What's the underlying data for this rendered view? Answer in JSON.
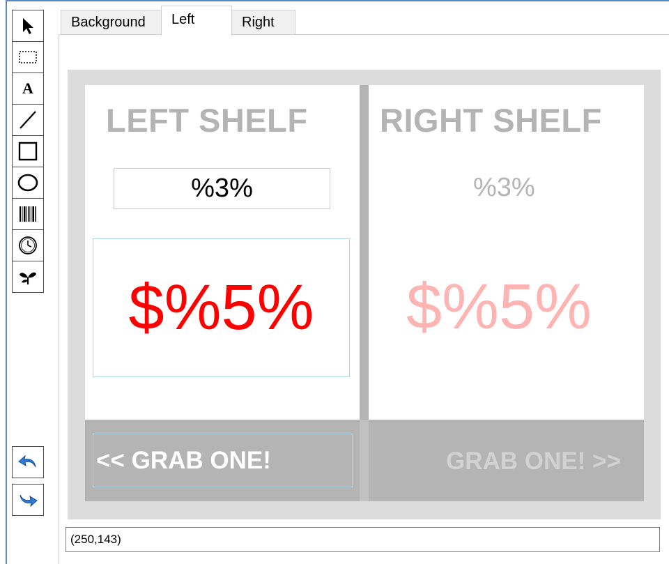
{
  "tools": [
    {
      "name": "pointer-icon"
    },
    {
      "name": "marquee-select-icon"
    },
    {
      "name": "text-icon",
      "glyph": "A"
    },
    {
      "name": "line-icon"
    },
    {
      "name": "rectangle-icon"
    },
    {
      "name": "ellipse-icon"
    },
    {
      "name": "barcode-icon"
    },
    {
      "name": "clock-icon"
    },
    {
      "name": "leaf-icon"
    }
  ],
  "history": [
    {
      "name": "undo-icon",
      "color": "#2e7bd6"
    },
    {
      "name": "redo-icon",
      "color": "#2e7bd6"
    }
  ],
  "tabs": [
    {
      "label": "Background",
      "active": false
    },
    {
      "label": "Left",
      "active": true
    },
    {
      "label": "Right",
      "active": false
    }
  ],
  "canvas": {
    "left_shelf": {
      "title": "LEFT SHELF",
      "percent_text": "%3%",
      "price_text": "$%5%",
      "grab_text": "<< GRAB ONE!"
    },
    "right_shelf": {
      "title": "RIGHT SHELF",
      "percent_text": "%3%",
      "price_text": "$%5%",
      "grab_text": "GRAB ONE! >>"
    }
  },
  "colors": {
    "title_gray": "#b4b4b4",
    "price_active": "#ff0000",
    "price_inactive": "#ffb4b4",
    "grab_active": "#ffffff",
    "grab_inactive": "#d2d2d2",
    "selection_border": "#a9d8e4"
  },
  "status": {
    "coordinates": "(250,143)"
  }
}
